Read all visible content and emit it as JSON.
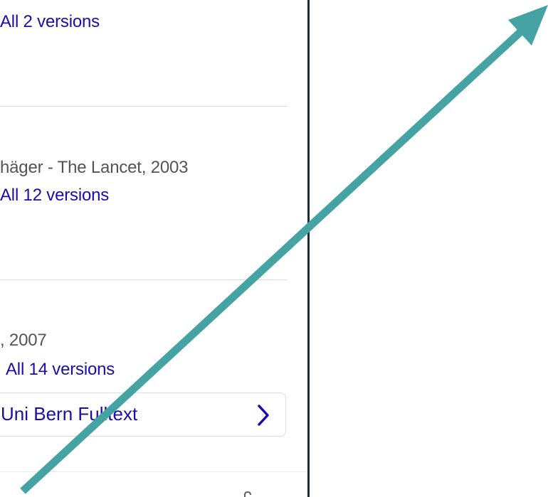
{
  "results": [
    {
      "versions_label": "All 2 versions"
    },
    {
      "meta": "häger - The Lancet, 2003",
      "versions_label": "All 12 versions"
    },
    {
      "meta": ", 2007",
      "versions_label": "All 14 versions",
      "fulltext_label": "Uni Bern Fulltext",
      "fulltext_icon": "chevron-right-icon"
    }
  ],
  "overlay": {
    "type": "arrow",
    "color": "#45a3a3"
  },
  "colors": {
    "link": "#1a0dab",
    "meta": "#545454",
    "divider": "#dadce0",
    "pane_border": "#1f2d33"
  }
}
